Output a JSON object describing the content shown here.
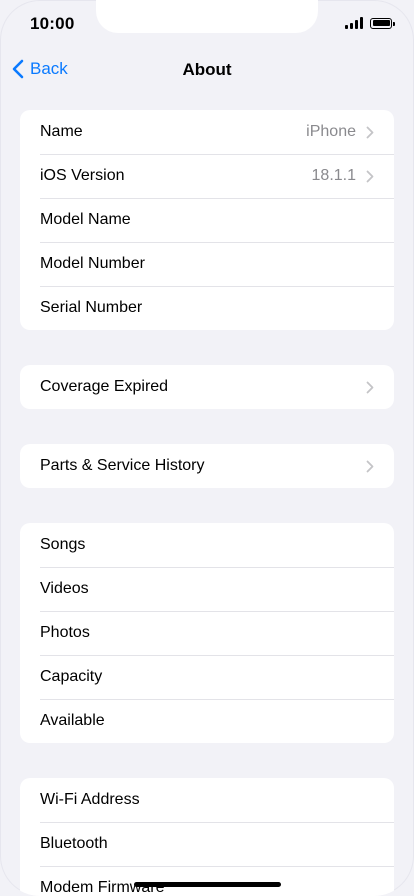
{
  "status_bar": {
    "time": "10:00"
  },
  "nav": {
    "back_label": "Back",
    "title": "About"
  },
  "groups": {
    "device": {
      "rows": [
        {
          "label": "Name",
          "value": "iPhone"
        },
        {
          "label": "iOS Version",
          "value": "18.1.1"
        },
        {
          "label": "Model Name"
        },
        {
          "label": "Model Number"
        },
        {
          "label": "Serial Number"
        }
      ]
    },
    "coverage": {
      "label": "Coverage Expired"
    },
    "parts": {
      "label": "Parts & Service History"
    },
    "media": {
      "rows": [
        {
          "label": "Songs"
        },
        {
          "label": "Videos"
        },
        {
          "label": "Photos"
        },
        {
          "label": "Capacity"
        },
        {
          "label": "Available"
        }
      ]
    },
    "network": {
      "rows": [
        {
          "label": "Wi-Fi Address"
        },
        {
          "label": "Bluetooth"
        },
        {
          "label": "Modem Firmware"
        }
      ]
    }
  },
  "colors": {
    "accent": "#0a7aff",
    "background": "#f2f2f7",
    "secondary_text": "#8a8a8e"
  }
}
